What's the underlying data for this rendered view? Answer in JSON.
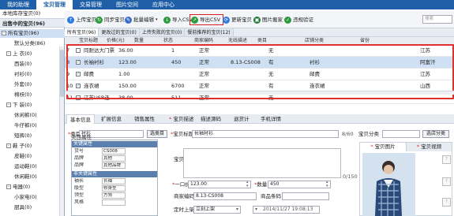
{
  "topnav": {
    "tabs": [
      "我的助理",
      "宝贝管理",
      "交易管理",
      "图片空间",
      "应用中心"
    ],
    "active": 1
  },
  "sidebar": {
    "header": "本地库存宝贝(0)",
    "section": "出售中的宝贝(96)",
    "items": [
      {
        "label": "所有宝贝(96)",
        "level": 0,
        "toggle": "-"
      },
      {
        "label": "默认分类(86)",
        "level": 2,
        "toggle": ""
      },
      {
        "label": "上 衣(0)",
        "level": 1,
        "toggle": "-"
      },
      {
        "label": "西装(0)",
        "level": 2,
        "toggle": ""
      },
      {
        "label": "衬衫(0)",
        "level": 2,
        "toggle": ""
      },
      {
        "label": "外套(0)",
        "level": 2,
        "toggle": ""
      },
      {
        "label": "棉袄(0)",
        "level": 2,
        "toggle": ""
      },
      {
        "label": "下 装(0)",
        "level": 1,
        "toggle": "-"
      },
      {
        "label": "休闲裤(0)",
        "level": 2,
        "toggle": ""
      },
      {
        "label": "牛仔裤(0)",
        "level": 2,
        "toggle": ""
      },
      {
        "label": "短裤(0)",
        "level": 2,
        "toggle": ""
      },
      {
        "label": "鞋  子(0)",
        "level": 1,
        "toggle": "-"
      },
      {
        "label": "皮鞋(0)",
        "level": 2,
        "toggle": ""
      },
      {
        "label": "运动鞋(0)",
        "level": 2,
        "toggle": ""
      },
      {
        "label": "休闲鞋(0)",
        "level": 2,
        "toggle": ""
      },
      {
        "label": "电器(0)",
        "level": 1,
        "toggle": "-"
      },
      {
        "label": "小家电(0)",
        "level": 2,
        "toggle": ""
      },
      {
        "label": "厨具(0)",
        "level": 2,
        "toggle": ""
      }
    ]
  },
  "toolbar": {
    "buttons": [
      {
        "label": "上传宝贝",
        "icon": "upload-icon",
        "color": "#2d7be0"
      },
      {
        "label": "同步宝贝",
        "icon": "sync-icon",
        "color": "#2d9a3c"
      },
      {
        "label": "批量编辑",
        "icon": "batch-edit-icon",
        "color": "#3b6fc9"
      },
      {
        "label": "导入CSV",
        "icon": "import-icon",
        "color": "#2d9a3c"
      },
      {
        "label": "导出CSV",
        "icon": "export-icon",
        "color": "#2d9a3c"
      },
      {
        "label": "更新宝贝",
        "icon": "refresh-icon",
        "color": "#2d7be0"
      },
      {
        "label": "图片搬家",
        "icon": "image-move-icon",
        "color": "#1e7a3a"
      },
      {
        "label": "违规验证",
        "icon": "verify-icon",
        "color": "#2d9a3c"
      }
    ],
    "search_placeholder": "搜索"
  },
  "filter_tabs": [
    "所有宝贝(96)",
    "更改过的宝贝(0)",
    "上传失败的宝贝(0)",
    "餐前推荐的宝贝(12)"
  ],
  "grid": {
    "headers": [
      "",
      "宝贝标题",
      "价格(元)",
      "数量",
      "状态",
      "商家编码",
      "无线描述",
      "类目",
      "店铺分类",
      "省份"
    ],
    "rows": [
      {
        "num": "7",
        "checked": false,
        "title": "同耐达大门票",
        "price": "36.00",
        "qty": "1",
        "status": "正常",
        "code": "",
        "wireless": "无",
        "category": "",
        "shop_cat": "",
        "province": "江苏"
      },
      {
        "num": "8",
        "checked": true,
        "title": "长袖衬衫",
        "price": "123.00",
        "qty": "450",
        "status": "正常",
        "code": "8.13-CS008",
        "wireless": "有",
        "category": "衬衫",
        "shop_cat": "",
        "province": "阿富汗"
      },
      {
        "num": "9",
        "checked": true,
        "title": "邮费",
        "price": "1.00",
        "qty": "",
        "status": "正常",
        "code": "",
        "wireless": "无",
        "category": "邮费",
        "shop_cat": "",
        "province": "江苏"
      },
      {
        "num": "10",
        "checked": true,
        "title": "连衣裙",
        "price": "150.00",
        "qty": "6700",
        "status": "正常",
        "code": "",
        "wireless": "有",
        "category": "连衣裙",
        "shop_cat": "",
        "province": "山西"
      },
      {
        "num": "11",
        "checked": false,
        "title": "江苏USB连",
        "price": "38.00",
        "qty": "511",
        "status": "正常",
        "code": "",
        "wireless": "无",
        "category": "",
        "shop_cat": "",
        "province": ""
      }
    ]
  },
  "detail_tabs": [
    "基本信息",
    "扩展信息",
    "销售属性",
    "宝贝描述",
    "描述源码",
    "退货计",
    "手机详情"
  ],
  "detail": {
    "category_label": "类目",
    "category_value": "衬衫",
    "select_category": "选类目",
    "title_label": "宝贝标题",
    "title_value": "长袖衬衫",
    "title_count": "8/60",
    "shop_cat_label": "宝贝分类",
    "shop_cat_btn": "选店分类",
    "attr_header": "类目属性",
    "attr_sections": [
      {
        "title": "关键属性",
        "rows": [
          {
            "k": "货号",
            "v": "CS008"
          },
          {
            "k": "品牌",
            "v": "其他"
          },
          {
            "k": "品牌",
            "v": "其他品牌"
          }
        ]
      },
      {
        "title": "非关键属性",
        "rows": [
          {
            "k": "袖长",
            "v": "长袖"
          },
          {
            "k": "版型",
            "v": "修身型"
          },
          {
            "k": "领型",
            "v": "方领"
          },
          {
            "k": "风格",
            "v": ""
          }
        ]
      }
    ],
    "selling_point_label": "宝贝卖点",
    "selling_point_count": "0/150",
    "price_label": "一口价",
    "price_value": "123.00",
    "qty_label": "数量",
    "qty_value": "450",
    "code_label": "商家编码",
    "code_value": "8.13-CS008",
    "barcode_label": "商品条码",
    "timer_label": "定时上架",
    "timer_value": "立刻上架",
    "timer_date": "2014/11/27 19:08:13"
  },
  "image_panel": {
    "tabs": [
      "宝贝图片",
      "宝贝视频"
    ],
    "slots": [
      "?",
      "?",
      "?"
    ]
  }
}
